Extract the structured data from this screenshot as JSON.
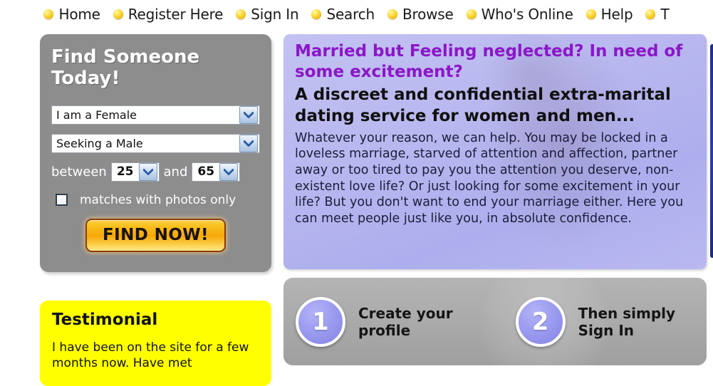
{
  "nav": {
    "bullet_color": "#f2bf13",
    "items": [
      {
        "label": "Home",
        "icon": "bullet-icon"
      },
      {
        "label": "Register Here",
        "icon": "bullet-icon"
      },
      {
        "label": "Sign In",
        "icon": "bullet-icon"
      },
      {
        "label": "Search",
        "icon": "bullet-icon"
      },
      {
        "label": "Browse",
        "icon": "bullet-icon"
      },
      {
        "label": "Who's Online",
        "icon": "bullet-icon"
      },
      {
        "label": "Help",
        "icon": "bullet-icon"
      },
      {
        "label": "T",
        "icon": "bullet-icon"
      }
    ]
  },
  "find_panel": {
    "title": "Find Someone\nToday!",
    "background_color": "#8d8d8d",
    "gender_select": {
      "value": "I am a Female",
      "icon": "chevron-down-icon"
    },
    "seeking_select": {
      "value": "Seeking a Male",
      "icon": "chevron-down-icon"
    },
    "age": {
      "between_label": "between",
      "min_value": "25",
      "and_label": "and",
      "max_value": "65",
      "icon": "chevron-down-icon"
    },
    "photos_checkbox": {
      "label": "matches with photos only",
      "checked": false
    },
    "submit_label": "FIND NOW!"
  },
  "testimonial": {
    "title": "Testimonial",
    "body": "I have been on the site for a few months now. Have met",
    "background_color": "#ffff00"
  },
  "promo": {
    "headline_purple": "Married but Feeling neglected? In need of some excitement?",
    "headline_purple_color": "#8b16c8",
    "headline_dark": "A discreet and confidential extra-marital dating service for women and men...",
    "body": "Whatever your reason, we can help. You may be locked in a loveless marriage, starved of attention and affection, partner away or too tired to pay you the attention you deserve, non-existent love life? Or just looking for some excitement in your life? But you don't want to end your marriage either. Here you can meet people just like you, in absolute confidence.",
    "background_color": "#b8b7ef"
  },
  "steps": {
    "background_color": "#acacac",
    "items": [
      {
        "number": "1",
        "text": "Create your\nprofile"
      },
      {
        "number": "2",
        "text": "Then simply\nSign In"
      }
    ]
  }
}
